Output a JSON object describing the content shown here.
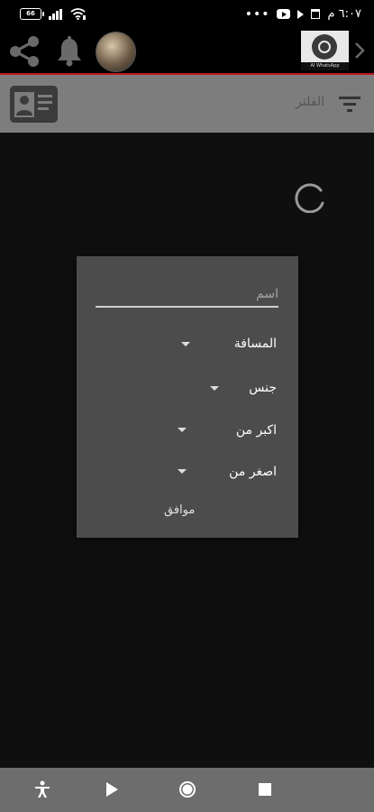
{
  "status_bar": {
    "battery": "66",
    "time": "٦:٠٧ م",
    "icons": [
      "battery-icon",
      "signal-icon",
      "wifi-icon",
      "more-icon",
      "youtube-icon",
      "play-icon",
      "trash-icon"
    ]
  },
  "toolbar": {
    "icons": [
      "share-icon",
      "bell-icon",
      "avatar",
      "whatsapp-card",
      "chevron-right-icon"
    ],
    "whatsapp_label": "AI WhatsApp"
  },
  "filter_bar": {
    "label": "الفلتر",
    "icons": [
      "contact-card-icon",
      "filter-icon"
    ]
  },
  "dialog": {
    "name_placeholder": "اسم",
    "distance_label": "المسافة",
    "gender_label": "جنس",
    "older_than_label": "اكبر من",
    "younger_than_label": "اصغر من",
    "ok_label": "موافق"
  },
  "nav_bar": {
    "icons": [
      "accessibility-icon",
      "play-icon",
      "home-circle-icon",
      "stop-icon"
    ]
  },
  "colors": {
    "accent_line": "#c0181c",
    "dialog_bg": "#4c4c4c",
    "filter_bar_bg": "#7d7d7d",
    "nav_bar_bg": "#6d6d6d"
  }
}
